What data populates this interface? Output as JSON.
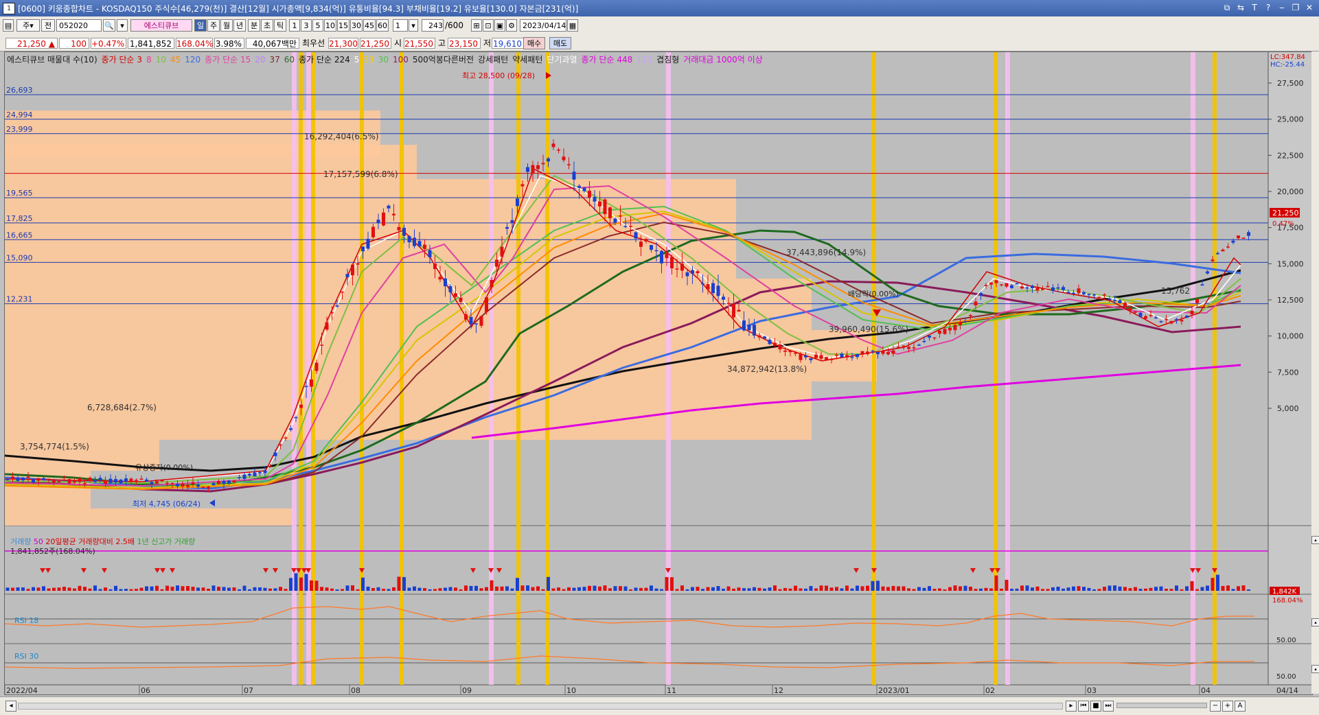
{
  "window": {
    "num": "1",
    "title": "[0600] 키움종합차트 - KOSDAQ150 주식수[46,279(천)] 결산[12월] 시가총액[9,834(억)] 유통비율[94.3] 부채비율[19.2] 유보율[130.0] 자본금[231(억)]",
    "buttons": [
      "⧉",
      "⇆",
      "T",
      "?",
      "‒",
      "❐",
      "✕"
    ]
  },
  "toolbar": {
    "type_sel": "주",
    "prev": "전",
    "code": "052020",
    "stock_name": "에스티큐브",
    "periods": [
      "일",
      "주",
      "월",
      "년",
      "분",
      "초",
      "틱"
    ],
    "active_period": "일",
    "intervals": [
      "1",
      "3",
      "5",
      "10",
      "15",
      "30",
      "45",
      "60"
    ],
    "count_a": "1",
    "count_b": "243",
    "count_total": "/600",
    "date": "2023/04/14"
  },
  "quote": {
    "price": "21,250",
    "change": "100",
    "change_pct": "+0.47%",
    "volume": "1,841,852",
    "vol_ratio": "168.04%",
    "turnover": "3.98%",
    "amount": "40,067백만",
    "best_label": "최우선",
    "best_ask": "21,300",
    "best_bid": "21,250",
    "open_label": "시",
    "open": "21,550",
    "high_label": "고",
    "high": "23,150",
    "low_label": "저",
    "low": "19,610",
    "buy": "매수",
    "sell": "매도"
  },
  "indicators_legend": [
    {
      "text": "에스티큐브 매물대 수(10)",
      "color": "#1a1a1a"
    },
    {
      "text": "종가 단순 3",
      "color": "#d40000"
    },
    {
      "text": "8",
      "color": "#e83e8c"
    },
    {
      "text": "10",
      "color": "#7fbf3f"
    },
    {
      "text": "45",
      "color": "#ff8c00"
    },
    {
      "text": "120",
      "color": "#3a6be0"
    },
    {
      "text": "종가 단순 15",
      "color": "#e040a0"
    },
    {
      "text": "20",
      "color": "#c080ff"
    },
    {
      "text": "37",
      "color": "#7a2a2a"
    },
    {
      "text": "60",
      "color": "#2a6a2a"
    },
    {
      "text": "종가 단순 224",
      "color": "#111111"
    },
    {
      "text": "5",
      "color": "#ffffff"
    },
    {
      "text": "33",
      "color": "#f0d000"
    },
    {
      "text": "30",
      "color": "#50c050"
    },
    {
      "text": "100",
      "color": "#8a1a5a"
    },
    {
      "text": "500억봉다른버전",
      "color": "#1a1a1a"
    },
    {
      "text": "강세패턴",
      "color": "#1a1a1a"
    },
    {
      "text": "약세패턴",
      "color": "#1a1a1a"
    },
    {
      "text": "단기과열",
      "color": "#ffffff"
    },
    {
      "text": "종가 단순 448",
      "color": "#e000e0"
    },
    {
      "text": "112",
      "color": "#c8a0ff"
    },
    {
      "text": "겹침형",
      "color": "#1a1a1a"
    },
    {
      "text": "거래대금 1000억 이상",
      "color": "#e000e0"
    }
  ],
  "axis": {
    "lc": "LC:347.84",
    "hc": "HC:-25.44",
    "y_ticks": [
      "27,500",
      "25,000",
      "22,500",
      "20,000",
      "17,500",
      "15,000",
      "12,500",
      "10,000",
      "7,500",
      "5,000"
    ],
    "price_label": "21,250",
    "price_pct": "0.47%",
    "h_levels": [
      "26,693",
      "24,994",
      "23,999",
      "19,565",
      "17,825",
      "16,665",
      "15,090",
      "12,231"
    ],
    "x_labels": [
      "2022/04",
      "06",
      "07",
      "08",
      "09",
      "10",
      "11",
      "12",
      "2023/01",
      "02",
      "03",
      "04",
      "04/14"
    ]
  },
  "annotations": {
    "high": "최고 28,500 (09/28)",
    "low": "최저 4,745 (06/24)",
    "rights": "유상증자(0.00%)",
    "dividend": "배당락(0.00%)",
    "vp1": "16,292,404(6.5%)",
    "vp2": "17,157,599(6.8%)",
    "vp3": "6,728,684(2.7%)",
    "vp4": "3,754,774(1.5%)",
    "vp5": "37,443,896(14.9%)",
    "vp6": "39,960,490(15.6%)",
    "vp7": "34,872,942(13.8%)",
    "vp8": "15,762"
  },
  "volume_panel": {
    "legend": [
      {
        "text": "거래량",
        "color": "#3a8ad0"
      },
      {
        "text": "50",
        "color": "#c000c0"
      },
      {
        "text": "20일평균 거래량대비 2.5배",
        "color": "#d40000"
      },
      {
        "text": "1년 신고가 거래량",
        "color": "#30a030"
      }
    ],
    "value": "1,841,852주(168.04%)",
    "last": "1,842K",
    "last_pct": "168.04%"
  },
  "rsi18": {
    "label": "RSI 18",
    "level": "50.00"
  },
  "rsi30": {
    "label": "RSI 30",
    "level": "50.00"
  }
}
